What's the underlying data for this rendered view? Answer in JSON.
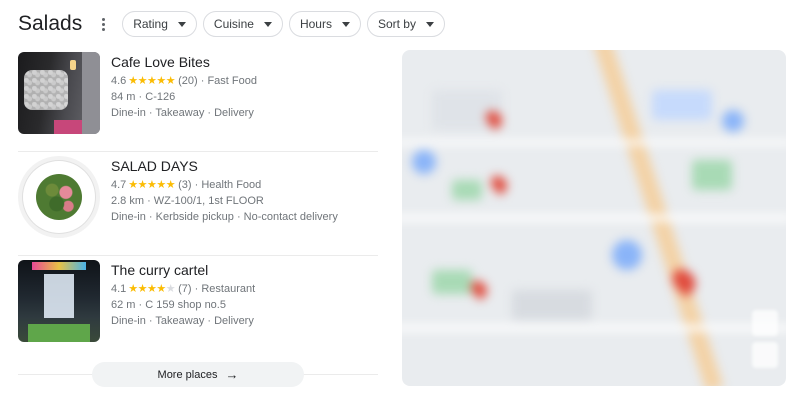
{
  "header": {
    "title": "Salads",
    "filters": [
      {
        "label": "Rating"
      },
      {
        "label": "Cuisine"
      },
      {
        "label": "Hours"
      },
      {
        "label": "Sort by"
      }
    ]
  },
  "places": [
    {
      "name": "Cafe Love Bites",
      "rating": "4.6",
      "stars": 4.6,
      "reviews": "(20)",
      "category": "Fast Food",
      "distance": "84 m",
      "address": "C-126",
      "services": "Dine-in · Takeaway · Delivery"
    },
    {
      "name": "SALAD DAYS",
      "rating": "4.7",
      "stars": 4.7,
      "reviews": "(3)",
      "category": "Health Food",
      "distance": "2.8 km",
      "address": "WZ-100/1, 1st FLOOR",
      "services": "Dine-in · Kerbside pickup · No-contact delivery"
    },
    {
      "name": "The curry cartel",
      "rating": "4.1",
      "stars": 4.1,
      "reviews": "(7)",
      "category": "Restaurant",
      "distance": "62 m",
      "address": "C 159 shop no.5",
      "services": "Dine-in · Takeaway · Delivery"
    }
  ],
  "more_button": {
    "label": "More places",
    "arrow": "→"
  },
  "icons": {
    "kebab": "more-vert-icon",
    "chip_caret": "caret-down-icon",
    "star": "star-icon",
    "arrow": "arrow-right-icon"
  },
  "colors": {
    "star": "#fbbc04",
    "star_empty": "#dadce0",
    "secondary_text": "#70757a",
    "map_pin": "#e04a3c"
  }
}
